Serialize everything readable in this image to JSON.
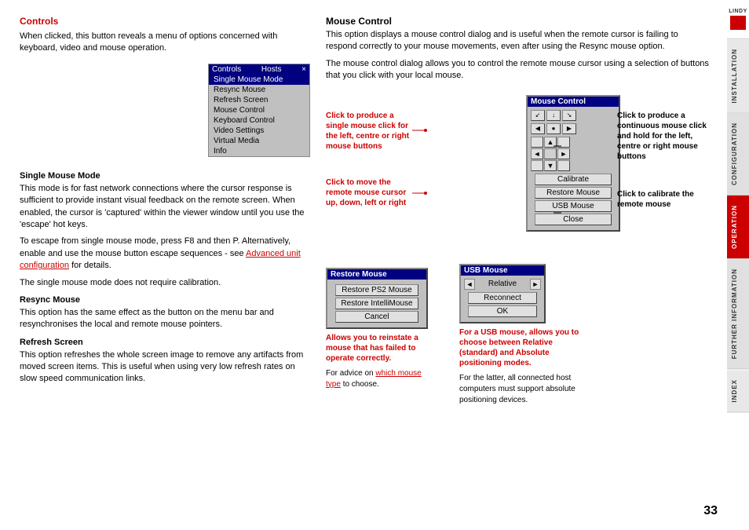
{
  "sidebar": {
    "logo_text": "LINDY",
    "tabs": [
      {
        "id": "installation",
        "label": "INSTALLATION",
        "active": false
      },
      {
        "id": "configuration",
        "label": "CONFIGURATION",
        "active": false
      },
      {
        "id": "operation",
        "label": "OPERATION",
        "active": true
      },
      {
        "id": "further",
        "label": "FURTHER INFORMATION",
        "active": false
      },
      {
        "id": "index",
        "label": "INDEX",
        "active": false
      }
    ]
  },
  "left_section": {
    "title": "Controls",
    "intro": "When clicked, this button reveals a menu of options concerned with keyboard, video and mouse operation.",
    "menu": {
      "title_left": "Controls",
      "title_right": "Hosts",
      "items": [
        {
          "label": "Single Mouse Mode",
          "selected": true
        },
        {
          "label": "Resync Mouse",
          "selected": false
        },
        {
          "label": "Refresh Screen",
          "selected": false
        },
        {
          "label": "Mouse Control",
          "selected": false
        },
        {
          "label": "Keyboard Control",
          "selected": false
        },
        {
          "label": "Video Settings",
          "selected": false
        },
        {
          "label": "Virtual Media",
          "selected": false
        },
        {
          "label": "Info",
          "selected": false
        }
      ]
    },
    "single_mouse": {
      "heading": "Single Mouse Mode",
      "text1": "This mode is for fast network connections where the cursor response is sufficient to provide instant visual feedback on the remote screen. When enabled, the cursor is 'captured' within the viewer window until you use the 'escape' hot keys.",
      "text2": "To escape from single mouse mode, press F8 and then P. Alternatively, enable and use the mouse button escape sequences - see",
      "link_text": "Advanced unit configuration",
      "text3": " for details.",
      "text4": "The single mouse mode does not require calibration."
    },
    "resync_mouse": {
      "heading": "Resync Mouse",
      "text": "This option has the same effect as the button on the menu bar and resynchronises the local and remote mouse pointers."
    },
    "refresh_screen": {
      "heading": "Refresh Screen",
      "text": "This option refreshes the whole screen image to remove any artifacts from moved screen items. This is useful when using very low refresh rates on slow speed communication links."
    }
  },
  "right_section": {
    "title": "Mouse Control",
    "intro": "This option displays a mouse control dialog and is useful when the remote cursor is failing to respond correctly to your mouse movements, even after using the Resync mouse option.",
    "description": "The mouse control dialog allows you to control the remote mouse cursor using a selection of buttons that you click with your local mouse.",
    "dialog": {
      "title": "Mouse Control",
      "btn_calibrate": "Calibrate",
      "btn_restore": "Restore Mouse",
      "btn_usb": "USB Mouse",
      "btn_close": "Close"
    },
    "annotations": {
      "click_single": "Click to produce a single mouse click for the left, centre or right mouse buttons",
      "click_continuous": "Click to produce a continuous mouse click and hold for the left, centre or right mouse buttons",
      "click_move": "Click to move the remote mouse cursor up, down, left or right",
      "click_calibrate": "Click to calibrate the remote mouse"
    },
    "restore_dialog": {
      "title": "Restore Mouse",
      "btn1": "Restore PS2 Mouse",
      "btn2": "Restore IntelliMouse",
      "btn3": "Cancel"
    },
    "restore_annotation": {
      "main": "Allows you to reinstate a mouse that has failed to operate correctly.",
      "sub": "For advice on",
      "link": "which mouse type",
      "sub2": " to choose."
    },
    "usb_dialog": {
      "title": "USB Mouse",
      "option": "Relative",
      "btn_reconnect": "Reconnect",
      "btn_ok": "OK"
    },
    "usb_annotation": {
      "main": "For a USB mouse, allows you to choose between Relative (standard) and Absolute positioning modes.",
      "sub": "For the latter, all connected host computers must support absolute positioning devices."
    }
  },
  "page_number": "33"
}
